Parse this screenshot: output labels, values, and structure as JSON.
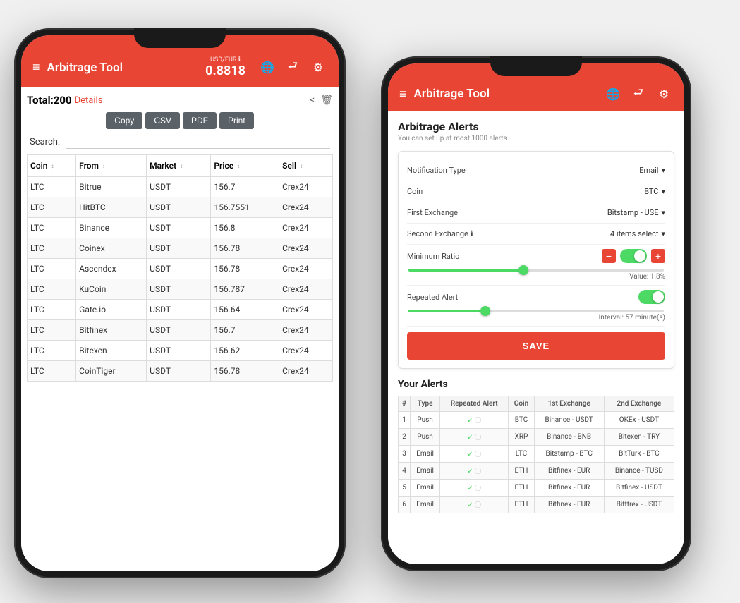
{
  "phone1": {
    "header": {
      "menu_label": "≡",
      "title": "Arbitrage Tool",
      "rate_label": "USD/EUR ℹ",
      "rate_value": "0.8818",
      "icons": [
        "🌐",
        "⮐",
        "⚙"
      ]
    },
    "content": {
      "total_label": "Total:",
      "total_count": "200",
      "details_link": "Details",
      "export_buttons": [
        "Copy",
        "CSV",
        "PDF",
        "Print"
      ],
      "search_label": "Search:",
      "table": {
        "headers": [
          "Coin",
          "From",
          "Market",
          "Price",
          "Sell"
        ],
        "rows": [
          [
            "LTC",
            "Bitrue",
            "USDT",
            "156.7",
            "Crex24"
          ],
          [
            "LTC",
            "HitBTC",
            "USDT",
            "156.7551",
            "Crex24"
          ],
          [
            "LTC",
            "Binance",
            "USDT",
            "156.8",
            "Crex24"
          ],
          [
            "LTC",
            "Coinex",
            "USDT",
            "156.78",
            "Crex24"
          ],
          [
            "LTC",
            "Ascendex",
            "USDT",
            "156.78",
            "Crex24"
          ],
          [
            "LTC",
            "KuCoin",
            "USDT",
            "156.787",
            "Crex24"
          ],
          [
            "LTC",
            "Gate.io",
            "USDT",
            "156.64",
            "Crex24"
          ],
          [
            "LTC",
            "Bitfinex",
            "USDT",
            "156.7",
            "Crex24"
          ],
          [
            "LTC",
            "Bitexen",
            "USDT",
            "156.62",
            "Crex24"
          ],
          [
            "LTC",
            "CoinTiger",
            "USDT",
            "156.78",
            "Crex24"
          ]
        ]
      }
    }
  },
  "phone2": {
    "header": {
      "menu_label": "≡",
      "title": "Arbitrage Tool",
      "icons": [
        "🌐",
        "⮐",
        "⚙"
      ]
    },
    "content": {
      "page_title": "Arbitrage Alerts",
      "page_subtitle": "You can set up at most 1000 alerts",
      "form": {
        "notification_type_label": "Notification Type",
        "notification_type_value": "Email",
        "coin_label": "Coin",
        "coin_value": "BTC",
        "first_exchange_label": "First Exchange",
        "first_exchange_value": "Bitstamp - USE",
        "second_exchange_label": "Second Exchange ℹ",
        "second_exchange_value": "4 items select",
        "min_ratio_label": "Minimum Ratio",
        "min_ratio_minus": "(-)",
        "min_ratio_plus": "(+)",
        "min_ratio_value": "Value: 1.8%",
        "min_ratio_fill": "45",
        "repeated_alert_label": "Repeated Alert",
        "repeated_alert_interval": "Interval: 57 minute(s)",
        "repeated_alert_fill": "30",
        "save_button": "SAVE"
      },
      "your_alerts": {
        "title": "Your Alerts",
        "headers": [
          "#",
          "Type",
          "Repeated Alert",
          "Coin",
          "1st Exchange",
          "2nd Exchange"
        ],
        "rows": [
          [
            "1",
            "Push",
            "✓ ⓘ",
            "BTC",
            "Binance - USDT",
            "OKEx - USDT"
          ],
          [
            "2",
            "Push",
            "✓ ⓘ",
            "XRP",
            "Binance - BNB",
            "Bitexen - TRY"
          ],
          [
            "3",
            "Email",
            "✓ ⓘ",
            "LTC",
            "Bitstamp - BTC",
            "BitTurk - BTC"
          ],
          [
            "4",
            "Email",
            "✓ ⓘ",
            "ETH",
            "Bitfinex - EUR",
            "Binance - TUSD"
          ],
          [
            "5",
            "Email",
            "✓ ⓘ",
            "ETH",
            "Bitfinex - EUR",
            "Bitfinex - USDT"
          ],
          [
            "6",
            "Email",
            "✓ ⓘ",
            "ETH",
            "Bitfinex - EUR",
            "Bitttrex - USDT"
          ]
        ]
      }
    }
  }
}
